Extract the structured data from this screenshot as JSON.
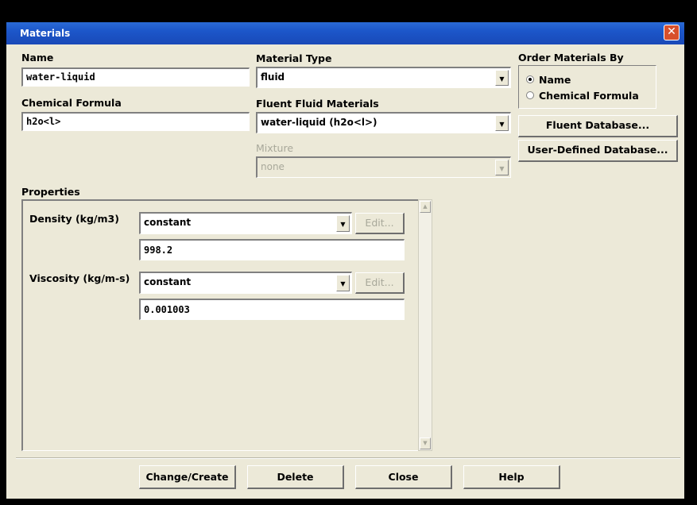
{
  "window": {
    "title": "Materials",
    "close_glyph": "✕"
  },
  "name": {
    "label": "Name",
    "value": "water-liquid"
  },
  "chemical_formula": {
    "label": "Chemical Formula",
    "value": "h2o<l>"
  },
  "material_type": {
    "label": "Material Type",
    "value": "fluid"
  },
  "fluent_fluid_materials": {
    "label": "Fluent Fluid Materials",
    "value": "water-liquid (h2o<l>)"
  },
  "mixture": {
    "label": "Mixture",
    "value": "none",
    "enabled": false
  },
  "order_by": {
    "label": "Order Materials By",
    "options": [
      {
        "label": "Name",
        "selected": true
      },
      {
        "label": "Chemical Formula",
        "selected": false
      }
    ]
  },
  "side_buttons": {
    "fluent_database": "Fluent Database...",
    "user_defined_database": "User-Defined Database..."
  },
  "properties": {
    "label": "Properties",
    "density": {
      "label": "Density (kg/m3)",
      "method": "constant",
      "edit_label": "Edit...",
      "value": "998.2"
    },
    "viscosity": {
      "label": "Viscosity (kg/m-s)",
      "method": "constant",
      "edit_label": "Edit...",
      "value": "0.001003"
    }
  },
  "footer": {
    "change_create": "Change/Create",
    "delete": "Delete",
    "close": "Close",
    "help": "Help"
  },
  "icons": {
    "dropdown": "dropdown-arrow-icon",
    "radio": "radio-icon",
    "close": "close-icon"
  },
  "colors": {
    "titlebar": "#1c56c9",
    "face": "#ece9d8",
    "close_button": "#d8502c"
  }
}
